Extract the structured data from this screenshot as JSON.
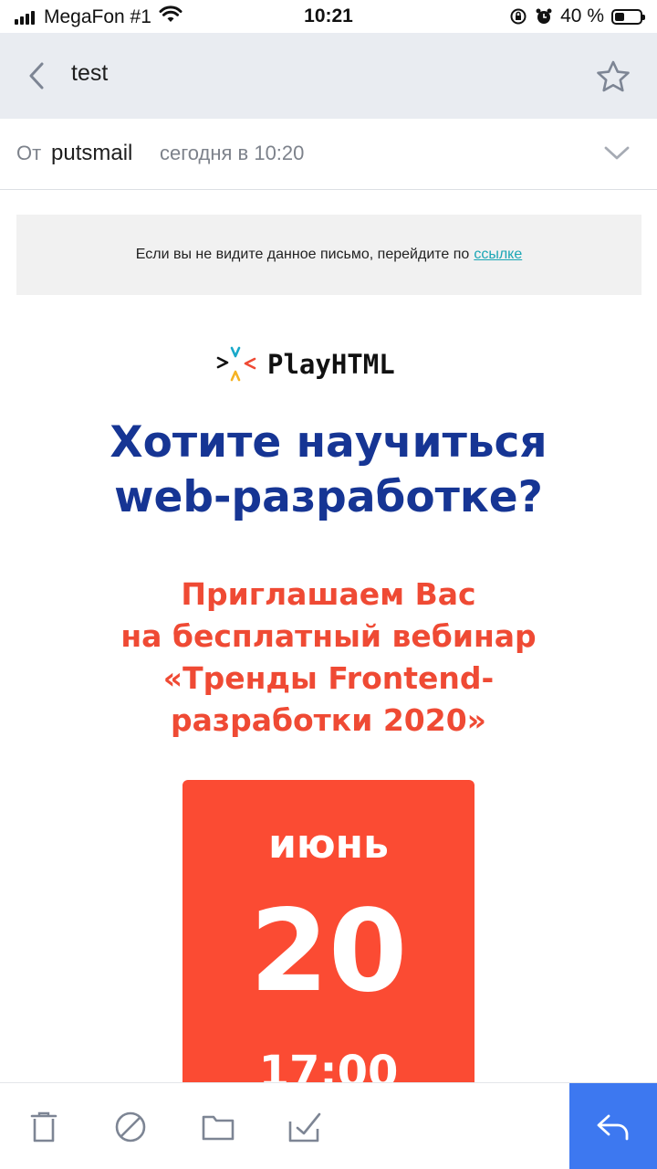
{
  "status_bar": {
    "carrier": "MegaFon #1",
    "time": "10:21",
    "battery": "40 %",
    "battery_level": 0.4
  },
  "header": {
    "title": "test",
    "icons": {
      "back": "chevron-left-icon",
      "favorite": "star-icon"
    }
  },
  "sender": {
    "from_label": "От",
    "name": "putsmail",
    "date": "сегодня в 10:20"
  },
  "email": {
    "notice_text": "Если вы не видите данное письмо, перейдите по",
    "notice_link": "ссылке",
    "logo_text": "PlayHTML",
    "headline_line1": "Хотите научиться",
    "headline_line2": "web-разработке?",
    "invite_line1": "Приглашаем Вас",
    "invite_line2": "на бесплатный вебинар",
    "invite_line3": "«Тренды Frontend-",
    "invite_line4": "разработки 2020»",
    "date_card": {
      "month": "июнь",
      "day": "20",
      "time": "17:00"
    },
    "colors": {
      "headline": "#163594",
      "accent": "#ef4a34",
      "card": "#fb4b33",
      "link": "#1ba6b5"
    }
  },
  "toolbar": {
    "icons": [
      "trash-icon",
      "spam-icon",
      "folder-icon",
      "mark-read-icon",
      "reply-icon"
    ],
    "reply_color": "#3d78f0"
  }
}
